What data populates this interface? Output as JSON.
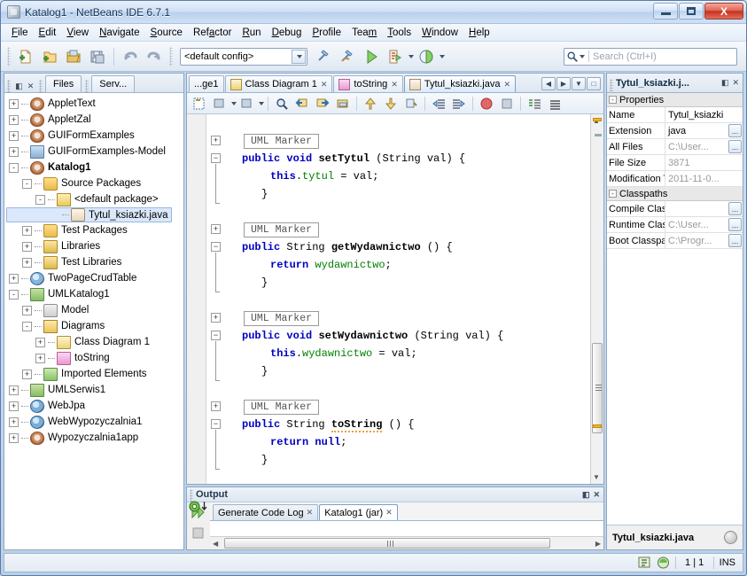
{
  "window": {
    "title": "Katalog1 - NetBeans IDE 6.7.1",
    "minimize_label": "Minimize",
    "maximize_label": "Maximize",
    "close_label": "X"
  },
  "menubar": {
    "items": [
      {
        "label": "File"
      },
      {
        "label": "Edit"
      },
      {
        "label": "View"
      },
      {
        "label": "Navigate"
      },
      {
        "label": "Source"
      },
      {
        "label": "Refactor"
      },
      {
        "label": "Run"
      },
      {
        "label": "Debug"
      },
      {
        "label": "Profile"
      },
      {
        "label": "Team"
      },
      {
        "label": "Tools"
      },
      {
        "label": "Window"
      },
      {
        "label": "Help"
      }
    ]
  },
  "toolbar": {
    "buttons": [
      {
        "name": "new-file-icon",
        "tip": "New File"
      },
      {
        "name": "new-project-icon",
        "tip": "New Project"
      },
      {
        "name": "open-project-icon",
        "tip": "Open Project"
      },
      {
        "name": "save-all-icon",
        "tip": "Save All"
      },
      {
        "name": "undo-icon",
        "tip": "Undo"
      },
      {
        "name": "redo-icon",
        "tip": "Redo"
      },
      {
        "name": "build-icon",
        "tip": "Build Main Project"
      },
      {
        "name": "clean-build-icon",
        "tip": "Clean and Build Main Project"
      },
      {
        "name": "run-icon",
        "tip": "Run Main Project"
      },
      {
        "name": "debug-icon",
        "tip": "Debug Main Project"
      },
      {
        "name": "profile-icon",
        "tip": "Profile Main Project"
      }
    ],
    "config_value": "<default config>",
    "search_placeholder": "Search (Ctrl+I)"
  },
  "explorer": {
    "tabs": [
      {
        "label": "Files",
        "active": false
      },
      {
        "label": "Serv...",
        "active": false
      }
    ],
    "minimize_label": "◧",
    "close_label": "✕",
    "tree": [
      {
        "label": "AppletText",
        "depth": 0,
        "toggle": "+",
        "icon": "java-project-icon",
        "icon_class": "ic-coffee",
        "bold": false,
        "selected": false
      },
      {
        "label": "AppletZal",
        "depth": 0,
        "toggle": "+",
        "icon": "java-project-icon",
        "icon_class": "ic-coffee",
        "bold": false,
        "selected": false
      },
      {
        "label": "GUIFormExamples",
        "depth": 0,
        "toggle": "+",
        "icon": "java-project-icon",
        "icon_class": "ic-coffee",
        "bold": false,
        "selected": false
      },
      {
        "label": "GUIFormExamples-Model",
        "depth": 0,
        "toggle": "+",
        "icon": "uml-project-icon",
        "icon_class": "ic-gui",
        "bold": false,
        "selected": false
      },
      {
        "label": "Katalog1",
        "depth": 0,
        "toggle": "-",
        "icon": "java-project-icon",
        "icon_class": "ic-coffee",
        "bold": true,
        "selected": false
      },
      {
        "label": "Source Packages",
        "depth": 1,
        "toggle": "-",
        "icon": "source-packages-icon",
        "icon_class": "ic-pkgfold",
        "bold": false,
        "selected": false
      },
      {
        "label": "<default package>",
        "depth": 2,
        "toggle": "-",
        "icon": "package-icon",
        "icon_class": "ic-pkg",
        "bold": false,
        "selected": false
      },
      {
        "label": "Tytul_ksiazki.java",
        "depth": 3,
        "toggle": "",
        "icon": "java-file-icon",
        "icon_class": "ic-javaf",
        "bold": false,
        "selected": true
      },
      {
        "label": "Test Packages",
        "depth": 1,
        "toggle": "+",
        "icon": "test-packages-icon",
        "icon_class": "ic-pkgfold",
        "bold": false,
        "selected": false
      },
      {
        "label": "Libraries",
        "depth": 1,
        "toggle": "+",
        "icon": "libraries-icon",
        "icon_class": "ic-lib",
        "bold": false,
        "selected": false
      },
      {
        "label": "Test Libraries",
        "depth": 1,
        "toggle": "+",
        "icon": "test-libraries-icon",
        "icon_class": "ic-lib",
        "bold": false,
        "selected": false
      },
      {
        "label": "TwoPageCrudTable",
        "depth": 0,
        "toggle": "+",
        "icon": "web-project-icon",
        "icon_class": "ic-crud",
        "bold": false,
        "selected": false
      },
      {
        "label": "UMLKatalog1",
        "depth": 0,
        "toggle": "-",
        "icon": "uml-project-icon",
        "icon_class": "ic-uml",
        "bold": false,
        "selected": false
      },
      {
        "label": "Model",
        "depth": 1,
        "toggle": "+",
        "icon": "model-icon",
        "icon_class": "ic-model",
        "bold": false,
        "selected": false
      },
      {
        "label": "Diagrams",
        "depth": 1,
        "toggle": "-",
        "icon": "diagrams-icon",
        "icon_class": "ic-diag",
        "bold": false,
        "selected": false
      },
      {
        "label": "Class Diagram 1",
        "depth": 2,
        "toggle": "+",
        "icon": "class-diagram-icon",
        "icon_class": "ic-cls",
        "bold": false,
        "selected": false
      },
      {
        "label": "toString",
        "depth": 2,
        "toggle": "+",
        "icon": "sequence-diagram-icon",
        "icon_class": "ic-tostr",
        "bold": false,
        "selected": false
      },
      {
        "label": "Imported Elements",
        "depth": 1,
        "toggle": "+",
        "icon": "imported-elements-icon",
        "icon_class": "ic-imp",
        "bold": false,
        "selected": false
      },
      {
        "label": "UMLSerwis1",
        "depth": 0,
        "toggle": "+",
        "icon": "uml-project-icon",
        "icon_class": "ic-uml",
        "bold": false,
        "selected": false
      },
      {
        "label": "WebJpa",
        "depth": 0,
        "toggle": "+",
        "icon": "web-project-icon",
        "icon_class": "ic-globe",
        "bold": false,
        "selected": false
      },
      {
        "label": "WebWypozyczalnia1",
        "depth": 0,
        "toggle": "+",
        "icon": "web-project-icon",
        "icon_class": "ic-globe",
        "bold": false,
        "selected": false
      },
      {
        "label": "Wypozyczalnia1app",
        "depth": 0,
        "toggle": "+",
        "icon": "java-project-icon",
        "icon_class": "ic-coffee",
        "bold": false,
        "selected": false
      }
    ]
  },
  "editor": {
    "tabs": [
      {
        "label": "...ge1",
        "icon": "",
        "active": false,
        "closeable": false
      },
      {
        "label": "Class Diagram 1",
        "icon": "class-diagram-icon",
        "active": false,
        "closeable": true
      },
      {
        "label": "toString",
        "icon": "sequence-diagram-icon",
        "active": false,
        "closeable": true
      },
      {
        "label": "Tytul_ksiazki.java",
        "icon": "java-file-icon",
        "active": true,
        "closeable": true
      }
    ],
    "tab_close_glyph": "✕",
    "nav_buttons": [
      {
        "name": "scroll-tabs-left-button",
        "glyph": "◀"
      },
      {
        "name": "scroll-tabs-right-button",
        "glyph": "▶"
      },
      {
        "name": "show-opened-documents-button",
        "glyph": "▼"
      },
      {
        "name": "maximize-window-button",
        "glyph": "□"
      }
    ],
    "toolbar_buttons": [
      {
        "name": "toggle-rectangular-selection-icon"
      },
      {
        "name": "previous-bookmark-icon"
      },
      {
        "name": "next-bookmark-icon"
      },
      {
        "name": "find-selection-icon"
      },
      {
        "name": "find-previous-icon"
      },
      {
        "name": "find-next-icon"
      },
      {
        "name": "toggle-highlight-icon"
      },
      {
        "name": "previous-error-icon"
      },
      {
        "name": "next-error-icon"
      },
      {
        "name": "toggle-bookmark-icon"
      },
      {
        "name": "shift-line-left-icon"
      },
      {
        "name": "shift-line-right-icon"
      },
      {
        "name": "start-macro-recording-icon"
      },
      {
        "name": "stop-macro-recording-icon"
      },
      {
        "name": "comment-icon"
      },
      {
        "name": "uncomment-icon"
      }
    ],
    "uml_marker_label": "UML Marker",
    "code_blocks": [
      {
        "marker": "UML Marker",
        "signature_parts": [
          {
            "text": "public",
            "cls": "kw"
          },
          {
            "text": " ",
            "cls": ""
          },
          {
            "text": "void",
            "cls": "kw"
          },
          {
            "text": " ",
            "cls": ""
          },
          {
            "text": "setTytul",
            "cls": "mname"
          },
          {
            "text": " (String val) {",
            "cls": ""
          }
        ],
        "body_parts": [
          {
            "text": "this",
            "cls": "kw"
          },
          {
            "text": ".",
            "cls": ""
          },
          {
            "text": "tytul",
            "cls": "fld"
          },
          {
            "text": " = val;",
            "cls": ""
          }
        ],
        "closing": "}"
      },
      {
        "marker": "UML Marker",
        "signature_parts": [
          {
            "text": "public",
            "cls": "kw"
          },
          {
            "text": " String ",
            "cls": ""
          },
          {
            "text": "getWydawnictwo",
            "cls": "mname"
          },
          {
            "text": " () {",
            "cls": ""
          }
        ],
        "body_parts": [
          {
            "text": "return",
            "cls": "kw"
          },
          {
            "text": " ",
            "cls": ""
          },
          {
            "text": "wydawnictwo",
            "cls": "fld"
          },
          {
            "text": ";",
            "cls": ""
          }
        ],
        "closing": "}"
      },
      {
        "marker": "UML Marker",
        "signature_parts": [
          {
            "text": "public",
            "cls": "kw"
          },
          {
            "text": " ",
            "cls": ""
          },
          {
            "text": "void",
            "cls": "kw"
          },
          {
            "text": " ",
            "cls": ""
          },
          {
            "text": "setWydawnictwo",
            "cls": "mname"
          },
          {
            "text": " (String val) {",
            "cls": ""
          }
        ],
        "body_parts": [
          {
            "text": "this",
            "cls": "kw"
          },
          {
            "text": ".",
            "cls": ""
          },
          {
            "text": "wydawnictwo",
            "cls": "fld"
          },
          {
            "text": " = val;",
            "cls": ""
          }
        ],
        "closing": "}"
      },
      {
        "marker": "UML Marker",
        "signature_parts": [
          {
            "text": "public",
            "cls": "kw"
          },
          {
            "text": " String ",
            "cls": ""
          },
          {
            "text": "toString",
            "cls": "mname squig"
          },
          {
            "text": " () {",
            "cls": ""
          }
        ],
        "body_parts": [
          {
            "text": "return",
            "cls": "kw"
          },
          {
            "text": " ",
            "cls": ""
          },
          {
            "text": "null",
            "cls": "kw"
          },
          {
            "text": ";",
            "cls": ""
          }
        ],
        "closing": "}"
      }
    ],
    "class_closing_brace": "}",
    "annotation_icon": "override-annotation-icon"
  },
  "output": {
    "title": "Output",
    "minimize_label": "◧",
    "close_label": "✕",
    "tabs": [
      {
        "label": "Generate Code Log",
        "active": false
      },
      {
        "label": "Katalog1 (jar)",
        "active": true
      }
    ],
    "tab_close_glyph": "✕",
    "side_buttons": [
      {
        "name": "rerun-output-icon"
      },
      {
        "name": "stop-output-icon"
      }
    ]
  },
  "properties": {
    "tab_label": "Tytul_ksiazki.j...",
    "minimize_label": "◧",
    "close_label": "✕",
    "sections": [
      {
        "title": "Properties",
        "toggle": "-",
        "rows": [
          {
            "name": "Name",
            "value": "Tytul_ksiazki",
            "dim": false,
            "ellipsis": false
          },
          {
            "name": "Extension",
            "value": "java",
            "dim": false,
            "ellipsis": true
          },
          {
            "name": "All Files",
            "value": "C:\\User...",
            "dim": true,
            "ellipsis": true
          },
          {
            "name": "File Size",
            "value": "3871",
            "dim": true,
            "ellipsis": false
          },
          {
            "name": "Modification Ti",
            "value": "2011-11-0...",
            "dim": true,
            "ellipsis": false
          }
        ]
      },
      {
        "title": "Classpaths",
        "toggle": "-",
        "rows": [
          {
            "name": "Compile Classp",
            "value": "",
            "dim": true,
            "ellipsis": true
          },
          {
            "name": "Runtime Class",
            "value": "C:\\User...",
            "dim": true,
            "ellipsis": true
          },
          {
            "name": "Boot Classpath",
            "value": "C:\\Progr...",
            "dim": true,
            "ellipsis": true
          }
        ]
      }
    ],
    "footer_label": "Tytul_ksiazki.java",
    "help_icon": "help-icon"
  },
  "statusbar": {
    "icons": [
      {
        "name": "insert-mode-icon"
      },
      {
        "name": "notifications-icon"
      }
    ],
    "position": "1 | 1",
    "insert_mode": "INS"
  }
}
